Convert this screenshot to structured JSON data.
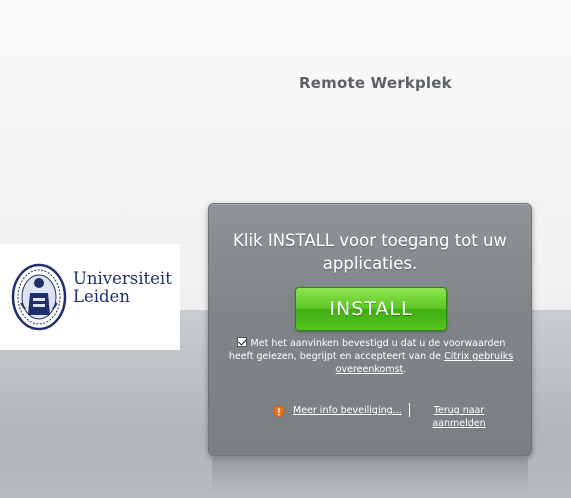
{
  "app": {
    "title": "Remote Werkplek"
  },
  "logo": {
    "line1": "Universiteit",
    "line2": "Leiden"
  },
  "panel": {
    "headline": "Klik INSTALL voor toegang tot uw applicaties.",
    "install_label": "INSTALL",
    "consent_text_1": "Met het aanvinken bevestigd u dat u de voorwaarden heeft gelezen, begrijpt en accepteert van de",
    "consent_link": "Citrix gebruiks overeenkomst",
    "consent_end": ".",
    "consent_checked": true,
    "security_link": "Meer info beveiliging...",
    "back_link": "Terug naar aanmelden"
  },
  "icons": {
    "seal": "university-seal-icon",
    "security": "shield-icon",
    "checkbox": "checkbox-checked"
  },
  "colors": {
    "accent_green": "#5dc826",
    "panel_gray": "#82878c",
    "title_gray": "#5d6167",
    "logo_blue": "#1f2f6e",
    "shield_orange": "#e8731c"
  }
}
